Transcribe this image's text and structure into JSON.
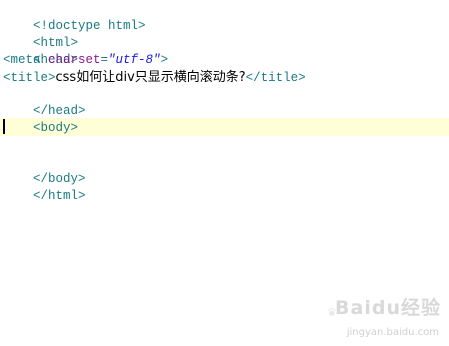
{
  "editor": {
    "lines": {
      "l1": {
        "tag": "<!doctype html>"
      },
      "l2": {
        "tag": "<html>"
      },
      "l3": {
        "tag": "<head>"
      },
      "l4": {
        "open": "<meta ",
        "attr": "charset",
        "eq": "=",
        "value": "\"utf-8\"",
        "close": ">"
      },
      "l5": {
        "open": "<title>",
        "text": "css如何让div只显示横向滚动条?",
        "close": "</title>"
      },
      "l6": {
        "tag": "</head>"
      },
      "l7": {
        "tag": "<body>"
      },
      "l8": {
        "tag": ""
      },
      "l9": {
        "tag": ""
      },
      "l10": {
        "tag": "</body>"
      },
      "l11": {
        "tag": "</html>"
      }
    },
    "highlight_color": "#fffed6",
    "tag_color": "#1a7a82",
    "attr_color": "#8b1a8b",
    "string_color": "#1a1adf"
  },
  "watermark": {
    "brand": "Baidu经验",
    "url": "jingyan.baidu.com"
  }
}
